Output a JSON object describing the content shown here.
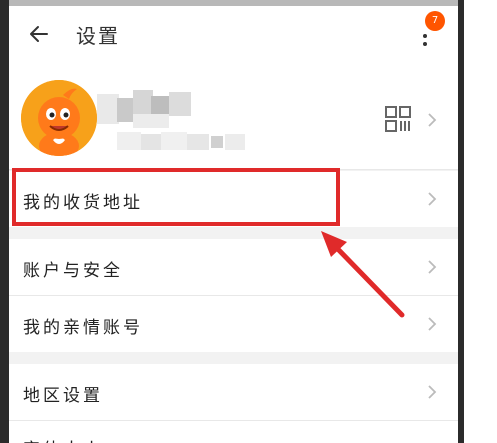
{
  "header": {
    "title": "设置",
    "badge_count": "7"
  },
  "icons": {
    "back": "arrow-left-icon",
    "more": "more-vertical-icon",
    "qr": "qr-code-icon",
    "chevron": "chevron-right-icon"
  },
  "menu": {
    "address": "我的收货地址",
    "account_security": "账户与安全",
    "family_account": "我的亲情账号",
    "region": "地区设置",
    "partial": "字体大小"
  },
  "colors": {
    "highlight": "#e02a2a",
    "badge": "#ff5500",
    "avatar_bg": "#f7a11a"
  }
}
